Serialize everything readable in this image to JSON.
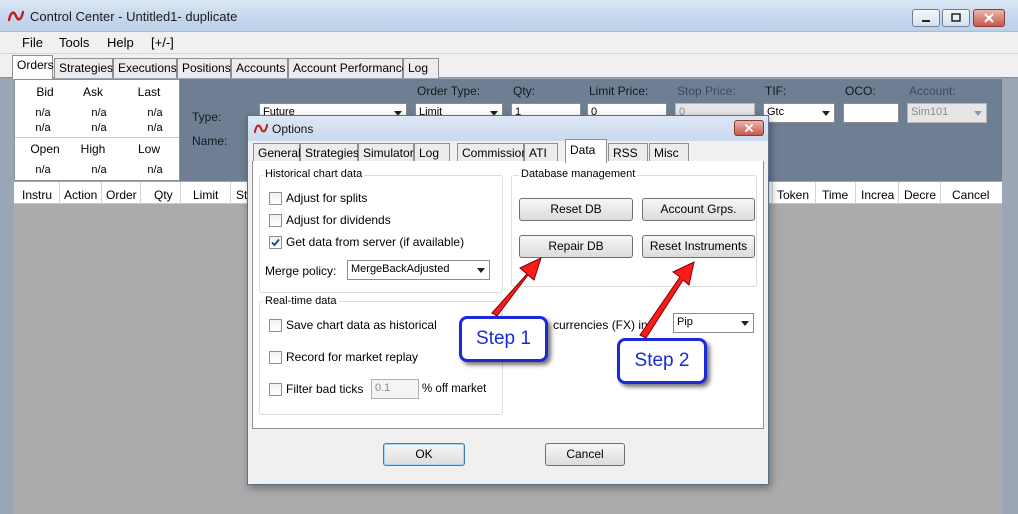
{
  "window": {
    "title": "Control Center - Untitled1- duplicate"
  },
  "menu": {
    "items": [
      "File",
      "Tools",
      "Help",
      "[+/-]"
    ]
  },
  "main_tabs": [
    "Orders",
    "Strategies",
    "Executions",
    "Positions",
    "Accounts",
    "Account Performance",
    "Log"
  ],
  "quote": {
    "headers_top": [
      "Bid",
      "Ask",
      "Last"
    ],
    "row1": [
      "n/a",
      "n/a",
      "n/a"
    ],
    "row2": [
      "n/a",
      "n/a",
      "n/a"
    ],
    "headers_bottom": [
      "Open",
      "High",
      "Low"
    ],
    "row3": [
      "n/a",
      "n/a",
      "n/a"
    ]
  },
  "order_entry": {
    "type_label": "Type:",
    "name_label": "Name:",
    "order_type_label": "Order Type:",
    "qty_label": "Qty:",
    "limit_price_label": "Limit Price:",
    "stop_price_label": "Stop Price:",
    "tif_label": "TIF:",
    "oco_label": "OCO:",
    "account_label": "Account:",
    "type_value": "Future",
    "order_type_value": "Limit",
    "qty_value": "1",
    "limit_price_value": "0",
    "stop_price_value": "0",
    "tif_value": "Gtc",
    "oco_value": "",
    "account_value": "Sim101"
  },
  "grid_columns_left": [
    "Instru",
    "Action",
    "Order",
    "Qty",
    "Limit",
    "St"
  ],
  "grid_columns_right": [
    "Token",
    "Time",
    "Increa",
    "Decre",
    "Cancel"
  ],
  "dialog": {
    "title": "Options",
    "tabs": [
      "General",
      "Strategies",
      "Simulator",
      "Log",
      "Commission",
      "ATI",
      "Data",
      "RSS",
      "Misc"
    ],
    "historical": {
      "label": "Historical chart data",
      "adjust_splits": "Adjust for splits",
      "adjust_dividends": "Adjust for dividends",
      "get_from_server": "Get data from server (if available)",
      "merge_policy_label": "Merge policy:",
      "merge_policy_value": "MergeBackAdjusted"
    },
    "realtime": {
      "label": "Real-time data",
      "save_historical": "Save chart data as historical",
      "record_replay": "Record for market replay",
      "filter_bad_ticks": "Filter bad ticks",
      "filter_value": "0.1",
      "off_market": "% off market"
    },
    "db": {
      "label": "Database management",
      "reset_db": "Reset DB",
      "account_grps": "Account Grps.",
      "repair_db": "Repair DB",
      "reset_instruments": "Reset Instruments"
    },
    "fx": {
      "label_partial": "currencies (FX) in",
      "value": "Pip"
    },
    "ok": "OK",
    "cancel": "Cancel"
  },
  "annotations": {
    "step1": "Step 1",
    "step2": "Step 2",
    "arrow_color": "#ff1a1a",
    "box_color": "#1a2bd6"
  }
}
